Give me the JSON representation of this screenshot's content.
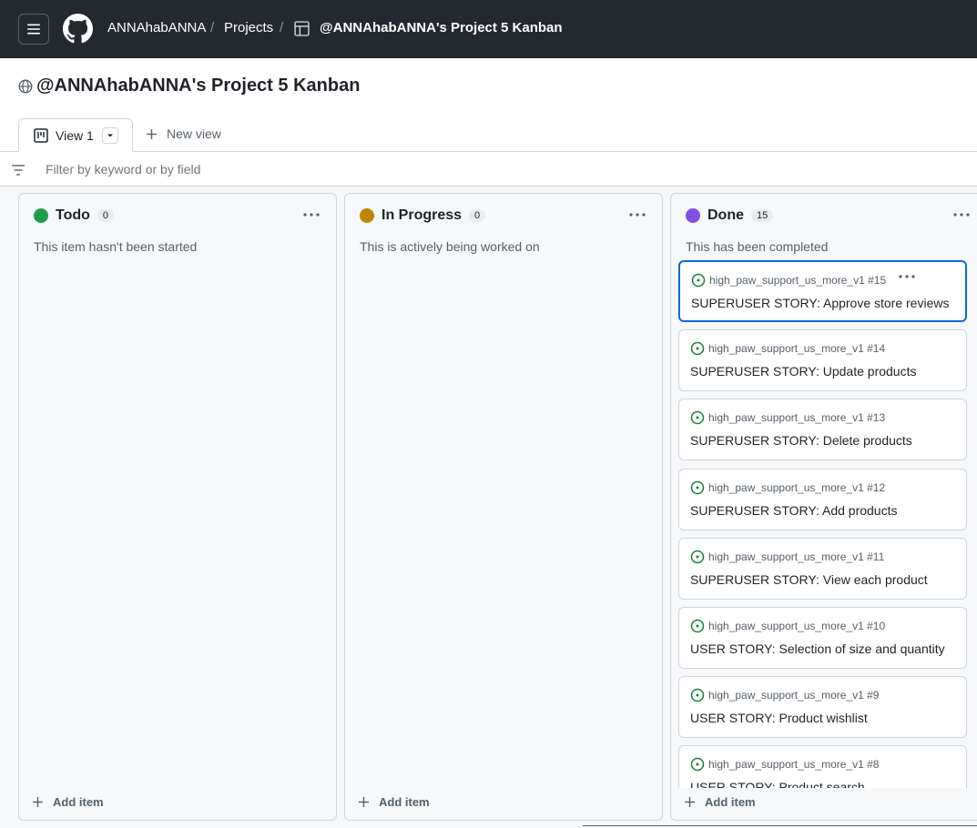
{
  "header": {
    "owner": "ANNAhabANNA",
    "projects": "Projects",
    "project_name": "@ANNAhabANNA's Project 5 Kanban",
    "separator": "/"
  },
  "page": {
    "title": "@ANNAhabANNA's Project 5 Kanban"
  },
  "tabs": {
    "active_label": "View 1",
    "new_view_label": "New view"
  },
  "filter": {
    "placeholder": "Filter by keyword or by field"
  },
  "colors": {
    "todo": "#1a7f37",
    "in_progress": "#bf8700",
    "done": "#8250df",
    "accent": "#0969da",
    "header_bg": "#24292f"
  },
  "columns": [
    {
      "title": "Todo",
      "count": "0",
      "description": "This item hasn't been started",
      "add_label": "Add item"
    },
    {
      "title": "In Progress",
      "count": "0",
      "description": "This is actively being worked on",
      "add_label": "Add item"
    },
    {
      "title": "Done",
      "count": "15",
      "description": "This has been completed",
      "add_label": "Add item",
      "cards": [
        {
          "ref": "high_paw_support_us_more_v1 #15",
          "title": "SUPERUSER STORY: Approve store reviews"
        },
        {
          "ref": "high_paw_support_us_more_v1 #14",
          "title": "SUPERUSER STORY: Update products"
        },
        {
          "ref": "high_paw_support_us_more_v1 #13",
          "title": "SUPERUSER STORY: Delete products"
        },
        {
          "ref": "high_paw_support_us_more_v1 #12",
          "title": "SUPERUSER STORY: Add products"
        },
        {
          "ref": "high_paw_support_us_more_v1 #11",
          "title": "SUPERUSER STORY: View each product"
        },
        {
          "ref": "high_paw_support_us_more_v1 #10",
          "title": "USER STORY: Selection of size and quantity"
        },
        {
          "ref": "high_paw_support_us_more_v1 #9",
          "title": "USER STORY: Product wishlist"
        },
        {
          "ref": "high_paw_support_us_more_v1 #8",
          "title": "USER STORY: Product search"
        }
      ]
    }
  ]
}
